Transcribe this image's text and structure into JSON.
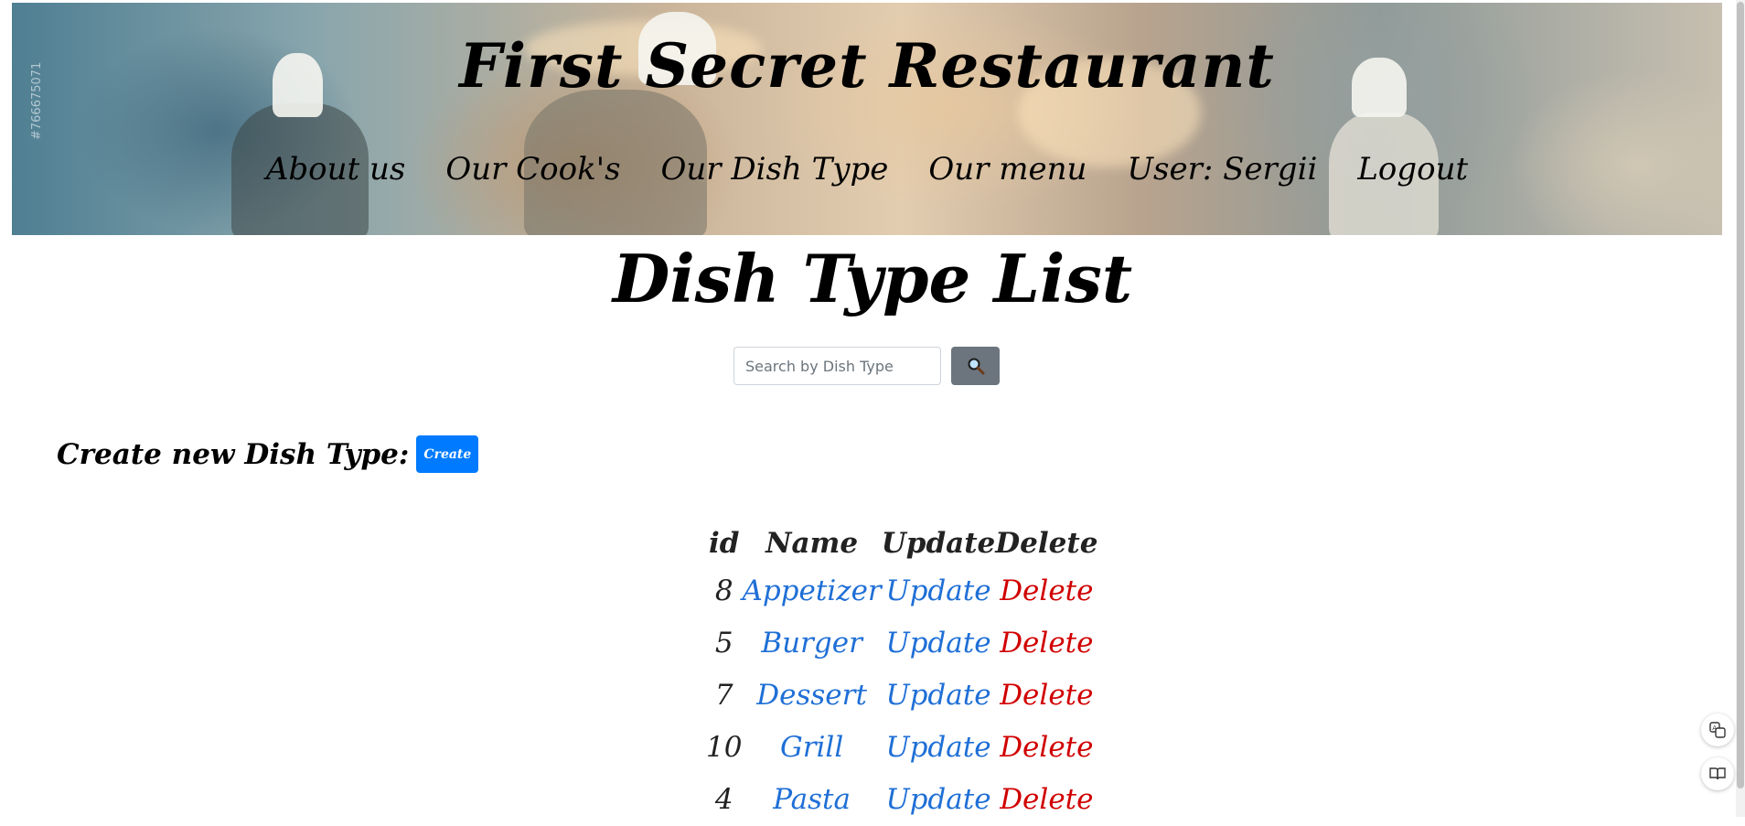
{
  "header": {
    "site_title": "First Secret Restaurant",
    "watermark": "#766675071",
    "nav": [
      {
        "label": "About us"
      },
      {
        "label": "Our Cook's"
      },
      {
        "label": "Our Dish Type"
      },
      {
        "label": "Our menu"
      },
      {
        "label": "User: Sergii"
      },
      {
        "label": "Logout"
      }
    ]
  },
  "main": {
    "page_title": "Dish Type List",
    "search": {
      "placeholder": "Search by Dish Type",
      "value": "",
      "button_icon": "search-icon"
    },
    "create": {
      "label": "Create new Dish Type:",
      "button_label": "Create"
    },
    "table": {
      "headers": [
        "id",
        "Name",
        "Update",
        "Delete"
      ],
      "rows": [
        {
          "id": "8",
          "name": "Appetizer",
          "update": "Update",
          "delete": "Delete"
        },
        {
          "id": "5",
          "name": "Burger",
          "update": "Update",
          "delete": "Delete"
        },
        {
          "id": "7",
          "name": "Dessert",
          "update": "Update",
          "delete": "Delete"
        },
        {
          "id": "10",
          "name": "Grill",
          "update": "Update",
          "delete": "Delete"
        },
        {
          "id": "4",
          "name": "Pasta",
          "update": "Update",
          "delete": "Delete"
        }
      ]
    }
  },
  "colors": {
    "link": "#1f6fd6",
    "delete": "#d10000",
    "create_button": "#007bff",
    "search_button": "#6c757d"
  },
  "side_icons": [
    "translate-icon",
    "reader-icon"
  ]
}
